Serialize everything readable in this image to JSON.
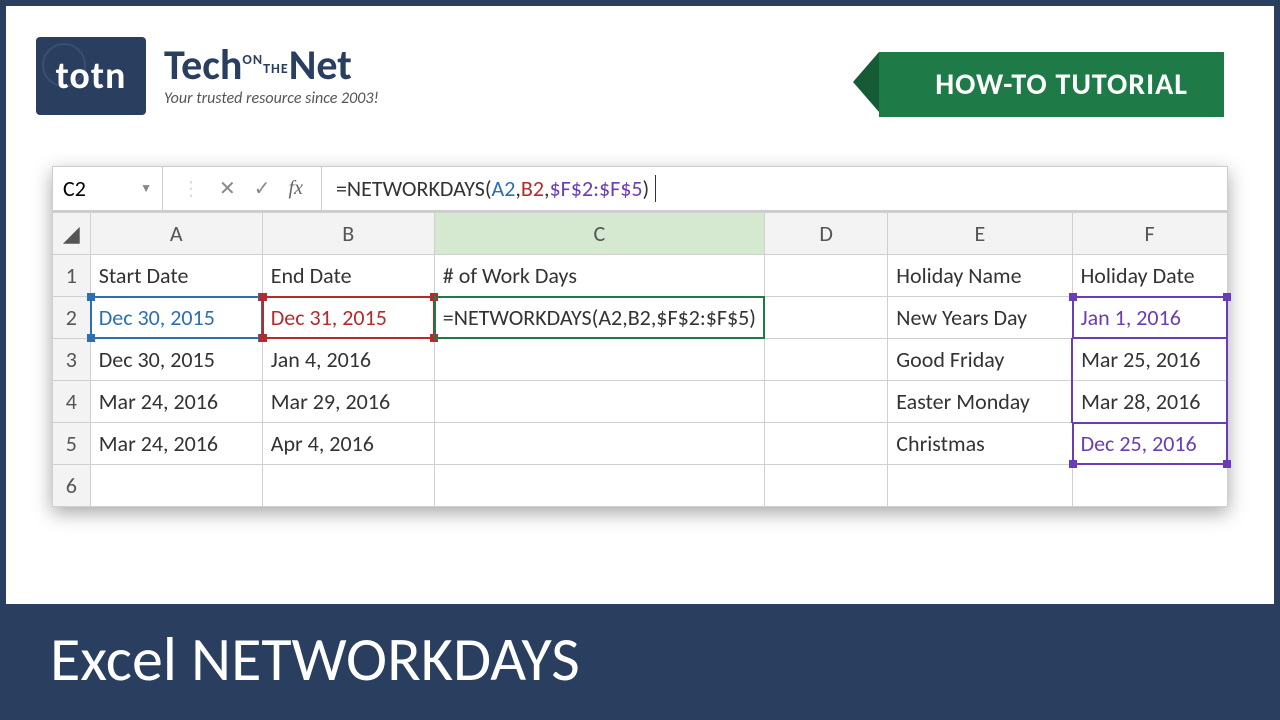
{
  "brand": {
    "badge": "totn",
    "name_tech": "Tech",
    "name_on": "ON",
    "name_the": "THE",
    "name_net": "Net",
    "tagline": "Your trusted resource since 2003!"
  },
  "ribbon": {
    "label": "HOW-TO TUTORIAL"
  },
  "formula_bar": {
    "name_box": "C2",
    "fx_label": "fx",
    "formula_prefix": "=NETWORKDAYS(",
    "ref_a": "A2",
    "ref_b": "B2",
    "ref_f": "$F$2:$F$5",
    "formula_close": ")"
  },
  "columns": [
    "A",
    "B",
    "C",
    "D",
    "E",
    "F"
  ],
  "rows": [
    {
      "n": "1",
      "A": "Start Date",
      "B": "End Date",
      "C": "# of Work Days",
      "D": "",
      "E": "Holiday Name",
      "F": "Holiday Date"
    },
    {
      "n": "2",
      "A": "Dec 30, 2015",
      "B": "Dec 31, 2015",
      "C": "=NETWORKDAYS(A2,B2,$F$2:$F$5)",
      "D": "",
      "E": "New Years Day",
      "F": "Jan 1, 2016"
    },
    {
      "n": "3",
      "A": "Dec 30, 2015",
      "B": "Jan 4, 2016",
      "C": "",
      "D": "",
      "E": "Good Friday",
      "F": "Mar 25, 2016"
    },
    {
      "n": "4",
      "A": "Mar 24, 2016",
      "B": "Mar 29, 2016",
      "C": "",
      "D": "",
      "E": "Easter Monday",
      "F": "Mar 28, 2016"
    },
    {
      "n": "5",
      "A": "Mar 24, 2016",
      "B": "Apr 4, 2016",
      "C": "",
      "D": "",
      "E": "Christmas",
      "F": "Dec 25, 2016"
    },
    {
      "n": "6",
      "A": "",
      "B": "",
      "C": "",
      "D": "",
      "E": "",
      "F": ""
    }
  ],
  "footer": {
    "title": "Excel NETWORKDAYS"
  }
}
